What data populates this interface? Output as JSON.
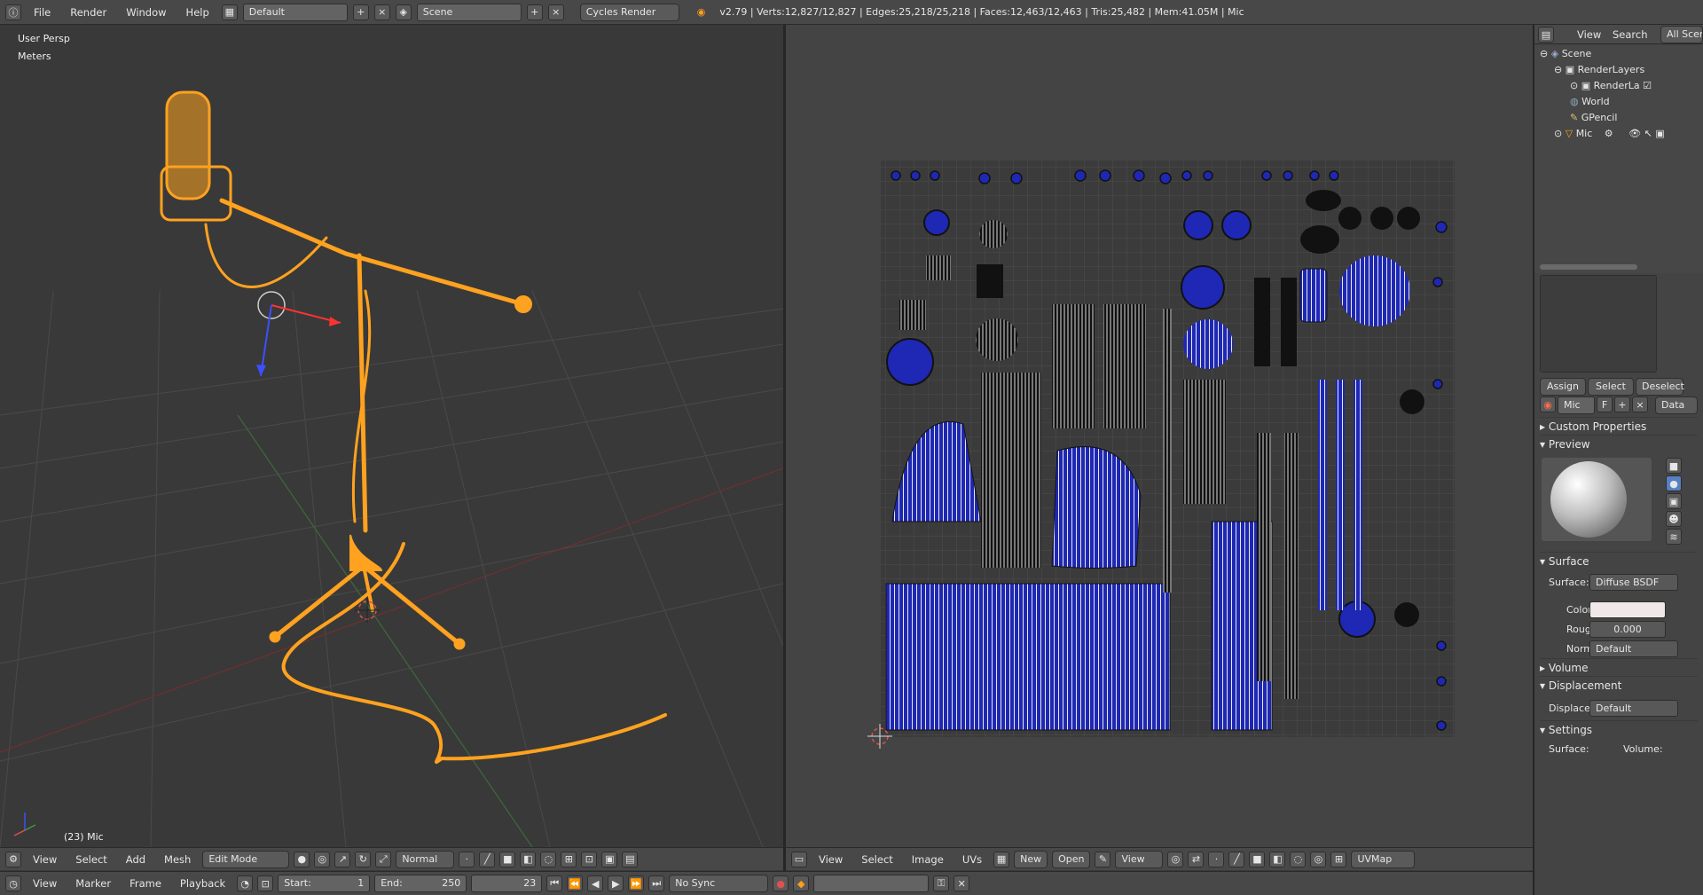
{
  "topbar": {
    "info_icon": "info-icon",
    "menus": [
      "File",
      "Render",
      "Window",
      "Help"
    ],
    "screen_layout": "Default",
    "scene": "Scene",
    "render_engine": "Cycles Render",
    "stats": "v2.79 | Verts:12,827/12,827 | Edges:25,218/25,218 | Faces:12,463/12,463 | Tris:25,482 | Mem:41.05M | Mic"
  },
  "viewport": {
    "view_name": "User Persp",
    "units": "Meters",
    "object_label": "(23) Mic",
    "footer": {
      "menus": [
        "View",
        "Select",
        "Add",
        "Mesh"
      ],
      "mode": "Edit Mode",
      "orientation": "Normal"
    }
  },
  "uv_editor": {
    "footer": {
      "menus": [
        "View",
        "Select",
        "Image",
        "UVs"
      ],
      "new": "New",
      "open": "Open",
      "view": "View",
      "uvmap": "UVMap"
    }
  },
  "timeline": {
    "menus": [
      "View",
      "Marker",
      "Frame",
      "Playback"
    ],
    "start_label": "Start:",
    "start": "1",
    "end_label": "End:",
    "end": "250",
    "current": "23",
    "sync": "No Sync"
  },
  "outliner": {
    "header": {
      "view": "View",
      "search": "Search",
      "filter": "All Scen"
    },
    "items": [
      "Scene",
      "RenderLayers",
      "RenderLa",
      "World",
      "GPencil",
      "Mic"
    ]
  },
  "properties": {
    "buttons": {
      "assign": "Assign",
      "select": "Select",
      "deselect": "Deselect"
    },
    "material_name": "Mic",
    "material_f": "F",
    "data_dropdown": "Data",
    "sections": {
      "custom_props": "Custom Properties",
      "preview": "Preview",
      "surface": "Surface",
      "volume": "Volume",
      "displacement": "Displacement",
      "settings": "Settings"
    },
    "surface_label": "Surface:",
    "surface_value": "Diffuse BSDF",
    "color_label": "Color:",
    "rough_label": "Rough",
    "rough_value": "0.000",
    "normal_label": "Norma",
    "normal_value": "Default",
    "displace_label": "Displace",
    "displace_value": "Default",
    "settings_surface": "Surface:",
    "settings_volume": "Volume:"
  },
  "colors": {
    "accent_orange": "#ff9e1b",
    "uv_blue": "#1e28b4"
  }
}
